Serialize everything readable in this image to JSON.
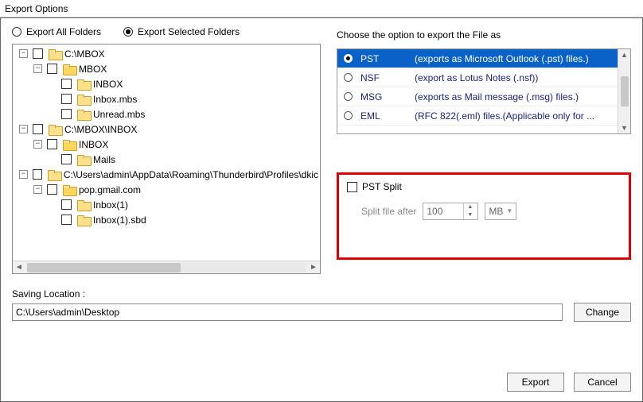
{
  "window": {
    "title": "Export Options"
  },
  "radios": {
    "all_label": "Export All Folders",
    "selected_label": "Export Selected Folders",
    "selected_checked": true
  },
  "tree": [
    {
      "indent": 0,
      "expander": "-",
      "label": "C:\\MBOX"
    },
    {
      "indent": 1,
      "expander": "-",
      "label": "MBOX",
      "open": true
    },
    {
      "indent": 2,
      "expander": "",
      "label": "INBOX"
    },
    {
      "indent": 2,
      "expander": "",
      "label": "Inbox.mbs"
    },
    {
      "indent": 2,
      "expander": "",
      "label": "Unread.mbs"
    },
    {
      "indent": 0,
      "expander": "-",
      "label": "C:\\MBOX\\INBOX"
    },
    {
      "indent": 1,
      "expander": "-",
      "label": "INBOX",
      "open": true
    },
    {
      "indent": 2,
      "expander": "",
      "label": "Mails"
    },
    {
      "indent": 0,
      "expander": "-",
      "label": "C:\\Users\\admin\\AppData\\Roaming\\Thunderbird\\Profiles\\dkic"
    },
    {
      "indent": 1,
      "expander": "-",
      "label": "pop.gmail.com",
      "open": true
    },
    {
      "indent": 2,
      "expander": "",
      "label": "Inbox(1)"
    },
    {
      "indent": 2,
      "expander": "",
      "label": "Inbox(1).sbd"
    }
  ],
  "right": {
    "title": "Choose the option to export the File as",
    "formats": [
      {
        "name": "PST",
        "desc": "(exports as Microsoft Outlook (.pst) files.)",
        "selected": true
      },
      {
        "name": "NSF",
        "desc": "(export as Lotus Notes (.nsf))"
      },
      {
        "name": "MSG",
        "desc": "(exports as Mail message (.msg) files.)"
      },
      {
        "name": "EML",
        "desc": "(RFC 822(.eml) files.(Applicable only for ..."
      }
    ]
  },
  "split": {
    "checkbox_label": "PST Split",
    "prefix": "Split file after",
    "value": "100",
    "unit": "MB"
  },
  "saving": {
    "label": "Saving Location :",
    "path": "C:\\Users\\admin\\Desktop",
    "change": "Change"
  },
  "buttons": {
    "export": "Export",
    "cancel": "Cancel"
  }
}
